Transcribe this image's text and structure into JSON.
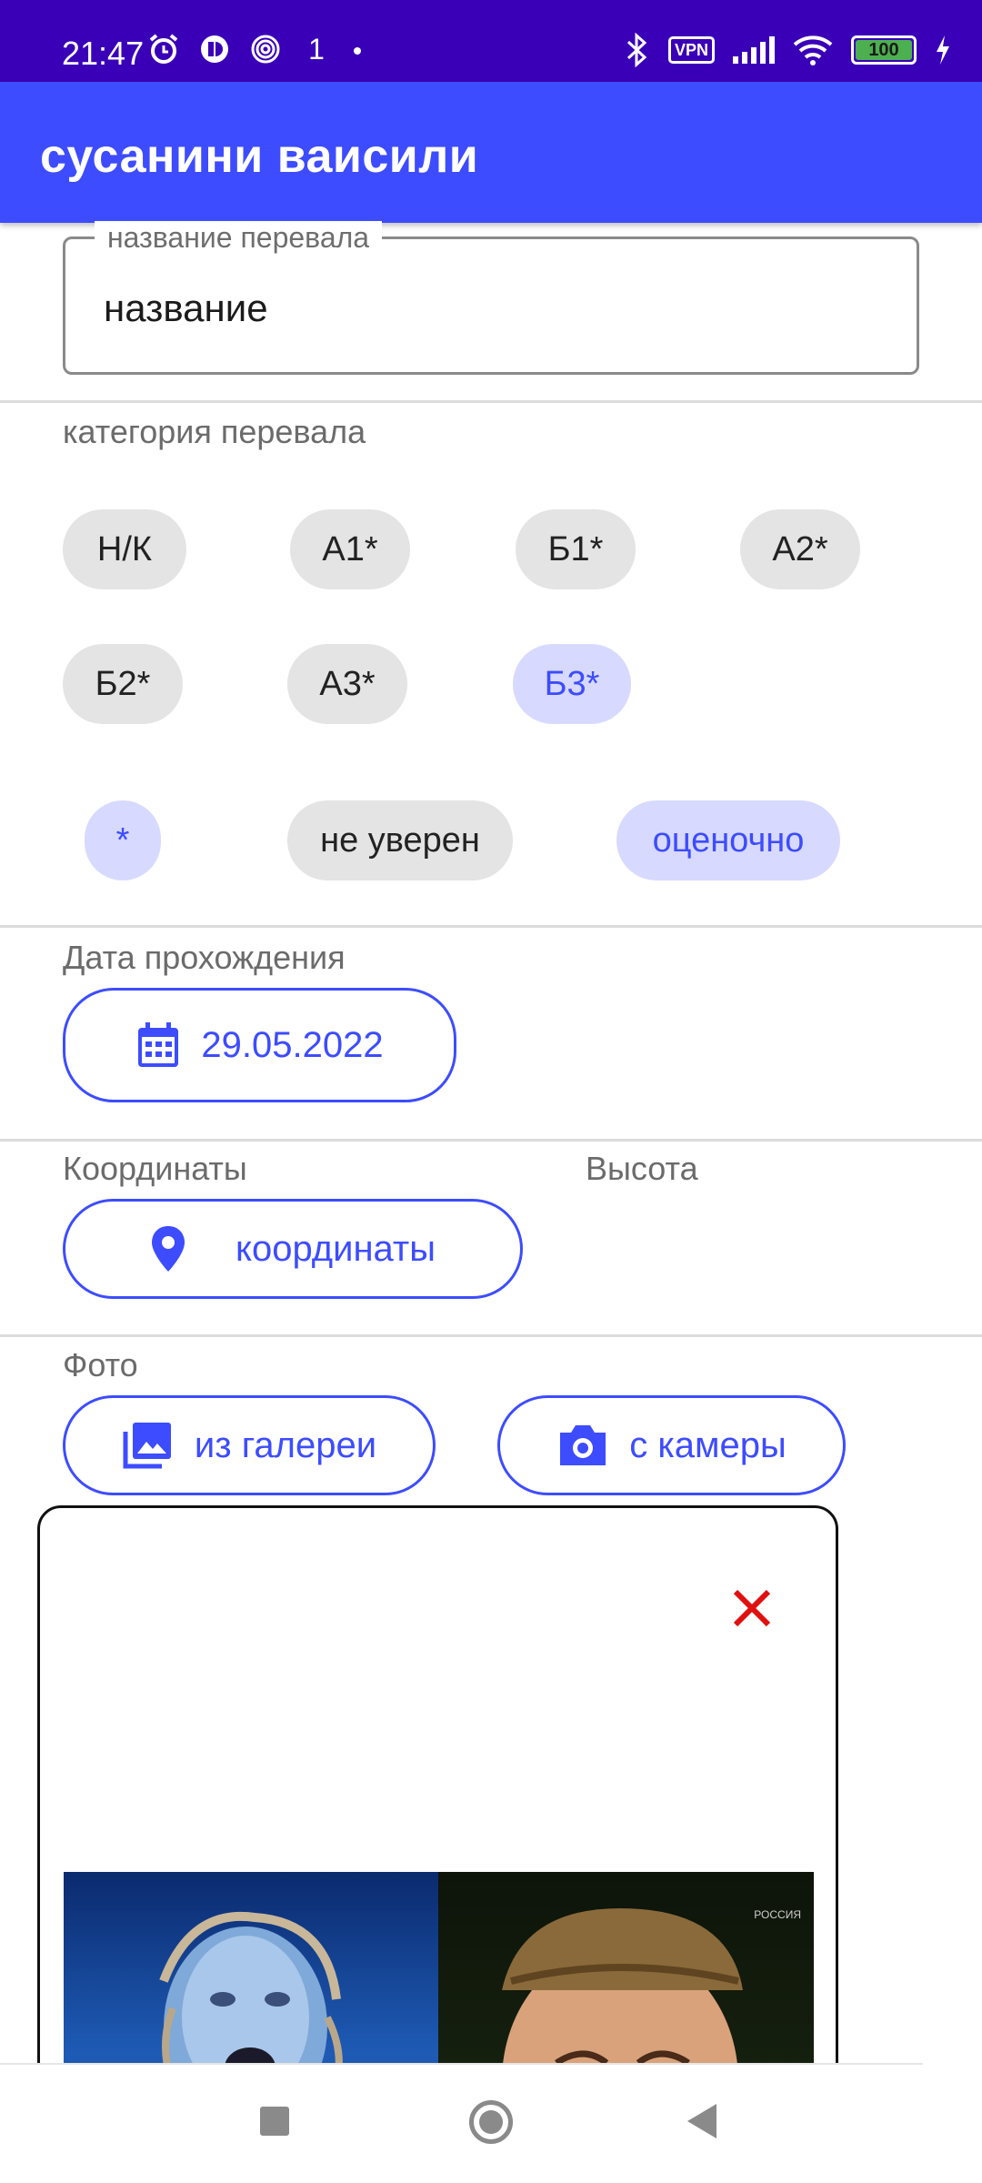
{
  "status_bar": {
    "time": "21:47",
    "notif_icons": [
      "alarm-icon",
      "app-icon",
      "spiral-icon",
      "one-icon",
      "dot-icon"
    ],
    "extra_text": "1",
    "vpn": "VPN",
    "battery": "100",
    "colors": {
      "background": "#3a00b8",
      "battery_fill": "#4caf50"
    }
  },
  "app_bar": {
    "title": "сусанини ваисили",
    "color": "#3d4cff"
  },
  "name_field": {
    "label": "название перевала",
    "value": "название"
  },
  "category": {
    "label": "категория перевала",
    "chips": [
      {
        "label": "Н/К",
        "selected": false
      },
      {
        "label": "А1*",
        "selected": false
      },
      {
        "label": "Б1*",
        "selected": false
      },
      {
        "label": "А2*",
        "selected": false
      },
      {
        "label": "Б2*",
        "selected": false
      },
      {
        "label": "А3*",
        "selected": false
      },
      {
        "label": "Б3*",
        "selected": true
      }
    ],
    "modifiers": [
      {
        "label": "*",
        "selected": true
      },
      {
        "label": "не уверен",
        "selected": false
      },
      {
        "label": "оценочно",
        "selected": true
      }
    ]
  },
  "date": {
    "label": "Дата прохождения",
    "value": "29.05.2022",
    "icon": "calendar-icon"
  },
  "coordinates": {
    "label": "Координаты",
    "button": "координаты",
    "icon": "location-pin-icon"
  },
  "altitude": {
    "label": "Высота"
  },
  "photo": {
    "label": "Фото",
    "gallery_button": "из галереи",
    "camera_button": "с камеры",
    "remove_icon": "close-icon",
    "watermark": "РОССИЯ"
  },
  "nav": {
    "recents": "recents-icon",
    "home": "home-icon",
    "back": "back-icon"
  }
}
